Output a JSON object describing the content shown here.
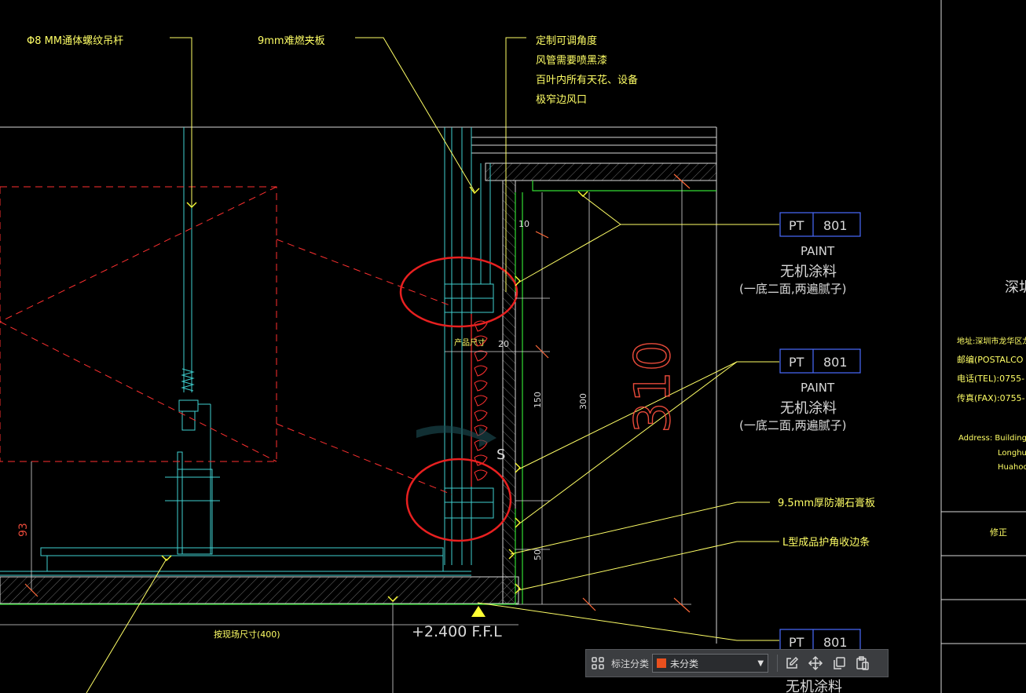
{
  "labels": {
    "rod": "Φ8 MM通体螺纹吊杆",
    "plywood": "9mm难燃夹板",
    "note_lines": [
      "定制可调角度",
      "风管需要喷黑漆",
      "百叶内所有天花、设备",
      "极窄边风口"
    ],
    "gypsum": "9.5mm厚防潮石膏板",
    "corner": "L型成品护角收边条",
    "ffl": "+2.400 F.F.L",
    "site": "按现场尺寸(400)",
    "product": "产品尺寸",
    "section_mark": "S",
    "big_dim": "310"
  },
  "dims": {
    "d10": "10",
    "d20": "20",
    "d150": "150",
    "d300": "300",
    "d50": "50",
    "d93": "93"
  },
  "tags": [
    {
      "code": "PT",
      "num": "801",
      "type": "PAINT",
      "material": "无机涂料",
      "note": "(一底二面,两遍腻子)"
    },
    {
      "code": "PT",
      "num": "801",
      "type": "PAINT",
      "material": "无机涂料",
      "note": "(一底二面,两遍腻子)"
    },
    {
      "code": "PT",
      "num": "801",
      "type": "",
      "material": "无机涂料",
      "note": ""
    }
  ],
  "titleblock": {
    "company_fragment": "深圳",
    "address_cn": "地址:深圳市龙华区龙华街",
    "postal": "邮编(POSTALCO",
    "tel": "电话(TEL):0755-",
    "fax": "传真(FAX):0755-",
    "address_en_1": "Address: Building",
    "address_en_2": "Longhu",
    "address_en_3": "Huahoo",
    "revision": "修正"
  },
  "toolbar": {
    "label": "标注分类",
    "select_value": "未分类",
    "select_color": "#e8501e"
  },
  "colors": {
    "yellow": "#ffff66",
    "cyan": "#3fd0d0",
    "green": "#33dd33",
    "red": "#ff3030",
    "white": "#d9d9d9",
    "blue_box": "#4a6cff",
    "dim_red": "#e84a3a"
  }
}
